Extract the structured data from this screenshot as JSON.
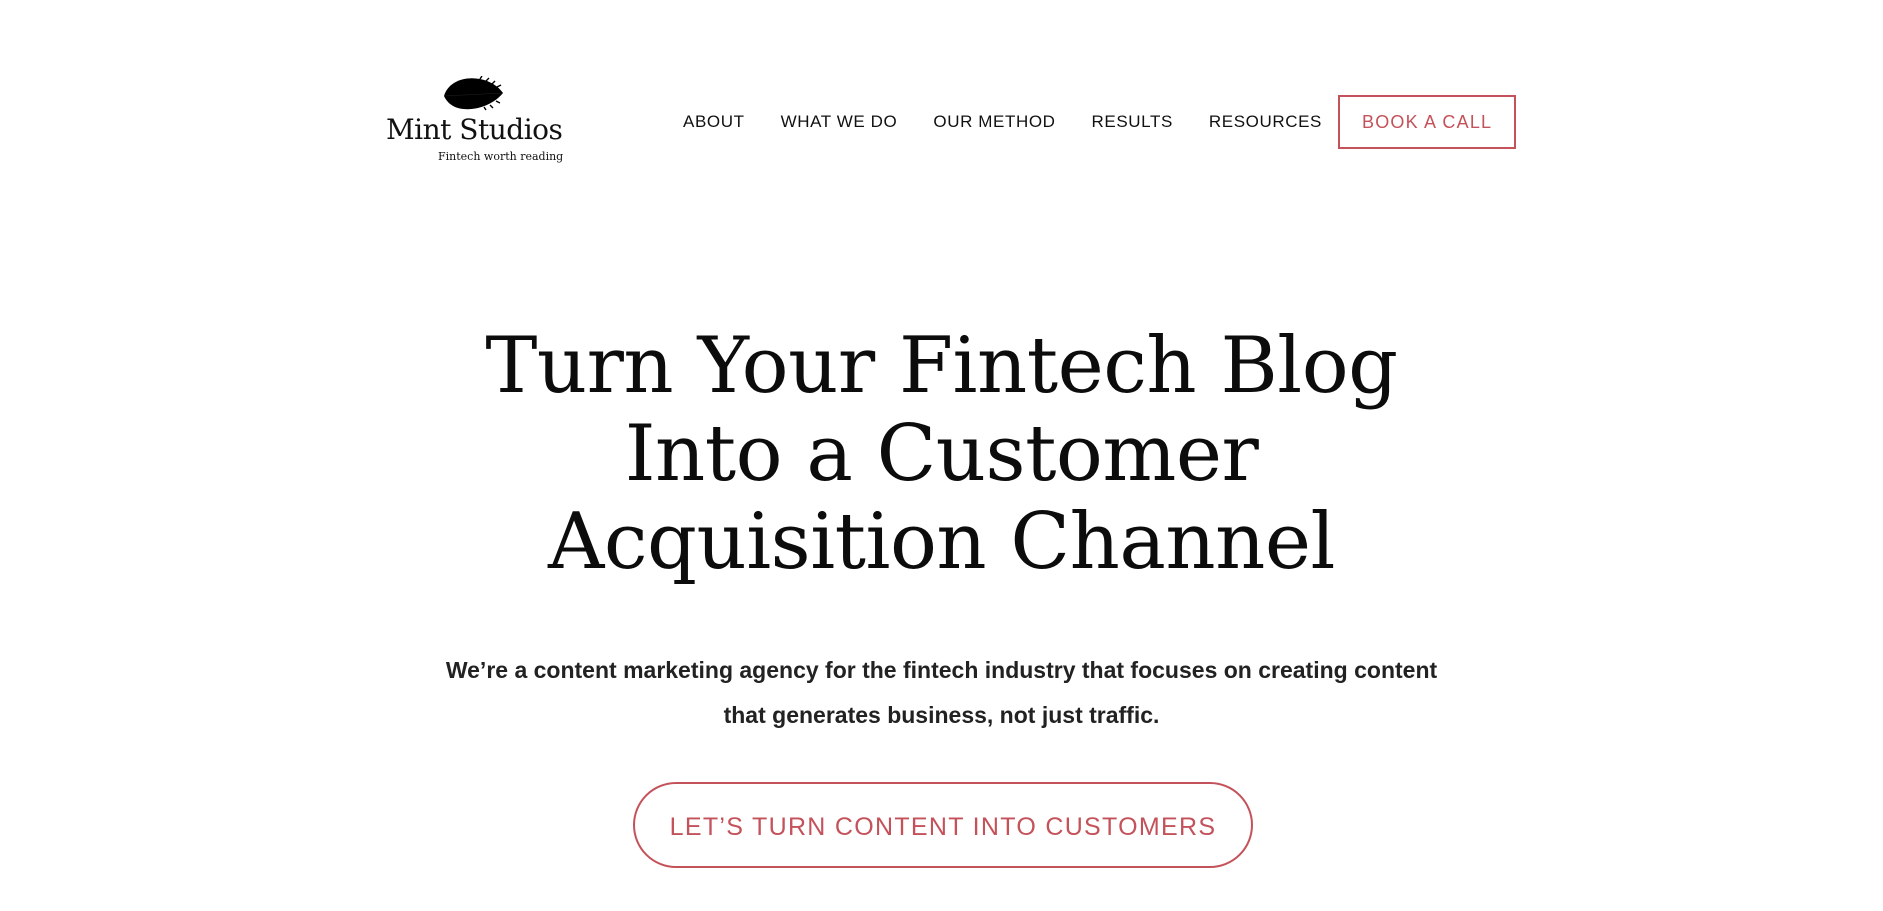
{
  "brand": {
    "name": "Mint Studios",
    "tagline": "Fintech worth reading",
    "logo_icon": "leaf-icon"
  },
  "nav": {
    "items": [
      {
        "label": "ABOUT"
      },
      {
        "label": "WHAT WE DO"
      },
      {
        "label": "OUR METHOD"
      },
      {
        "label": "RESULTS"
      },
      {
        "label": "RESOURCES"
      }
    ],
    "cta_label": "BOOK A CALL"
  },
  "hero": {
    "title_lines": [
      "Turn Your Fintech Blog",
      "Into a Customer",
      "Acquisition Channel"
    ],
    "subtitle_lines": [
      "We’re a content marketing agency for the fintech industry that focuses on creating content",
      "that generates business, not just traffic."
    ],
    "cta_label": "LET’S TURN CONTENT INTO CUSTOMERS"
  },
  "colors": {
    "accent": "#c4525a",
    "text": "#111111",
    "background": "#ffffff"
  }
}
